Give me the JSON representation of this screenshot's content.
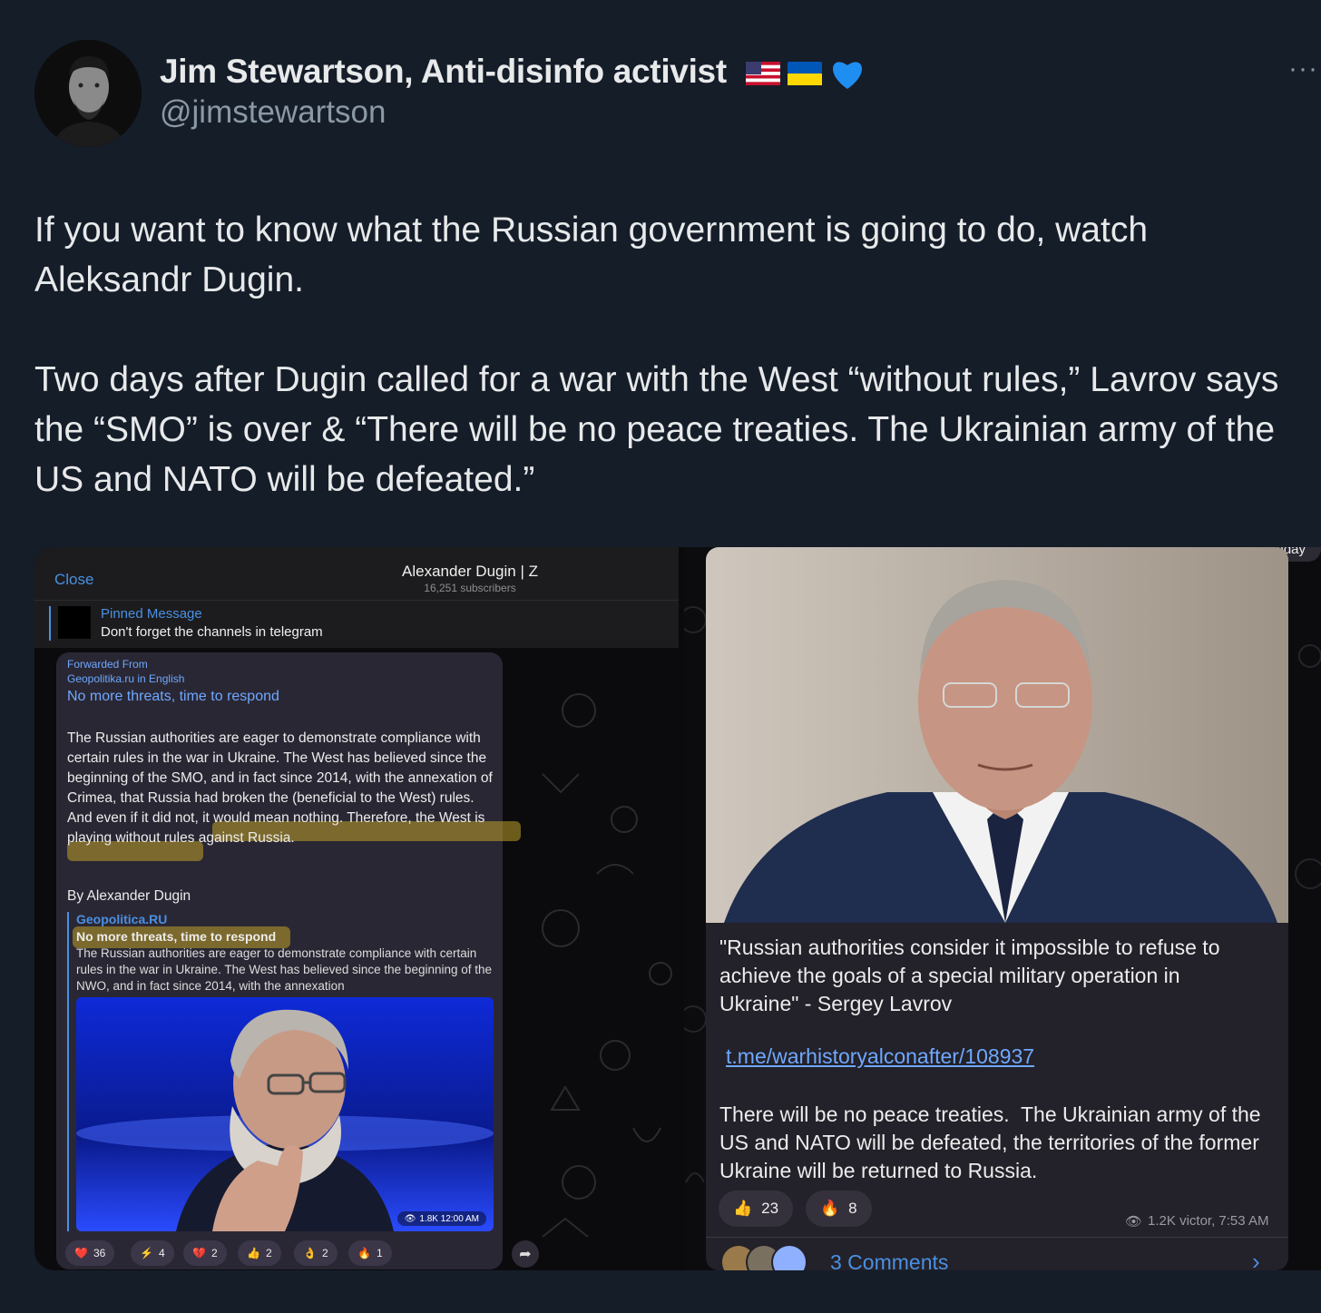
{
  "tweet": {
    "author_name": "Jim Stewartson, Anti-disinfo activist",
    "handle": "@jimstewartson",
    "more_label": "···",
    "text": "If you want to know what the Russian government is going to do, watch Aleksandr Dugin.\n\nTwo days after Dugin called for a war with the West “without rules,” Lavrov says the “SMO” is over & “There will be no peace treaties. The Ukrainian army of the US and NATO will be defeated.”",
    "flag_icons": [
      "us-flag-icon",
      "ukraine-flag-icon",
      "blue-heart-icon"
    ]
  },
  "left_screenshot": {
    "close_label": "Close",
    "channel_name": "Alexander Dugin | Z",
    "subscribers": "16,251 subscribers",
    "pinned_title": "Pinned Message",
    "pinned_text": "Don't forget the channels in telegram",
    "forwarded_label": "Forwarded From",
    "forwarded_source": "Geopolitika.ru in English",
    "headline": "No more threats, time to respond",
    "body": "The Russian authorities are eager to demonstrate compliance with certain rules in the war in Ukraine. The West has believed since the beginning of the SMO, and in fact since 2014, with the annexation of Crimea, that Russia had broken the (beneficial to the West) rules. And even if it did not, it would mean nothing. Therefore, the West is playing without rules against Russia.",
    "byline": "By Alexander Dugin",
    "preview_site": "Geopolitica.RU",
    "preview_title": "No more threats, time to respond",
    "preview_text": "The Russian authorities are eager to demonstrate compliance with certain rules in the war in Ukraine. The West has believed since the beginning of the NWO, and in fact since 2014, with the annexation",
    "image_meta": "1.8K 12:00 AM",
    "reactions": [
      {
        "emoji": "❤️",
        "count": "36"
      },
      {
        "emoji": "⚡",
        "count": "4"
      },
      {
        "emoji": "💔",
        "count": "2"
      },
      {
        "emoji": "👍",
        "count": "2"
      },
      {
        "emoji": "👌",
        "count": "2"
      },
      {
        "emoji": "🔥",
        "count": "1"
      }
    ]
  },
  "right_screenshot": {
    "date_chip": "Today",
    "quote": "\"Russian authorities consider it impossible to refuse to achieve the goals of a special military operation in Ukraine\" - Sergey Lavrov",
    "link": "t.me/warhistoryalconafter/108937",
    "body": "There will be no peace treaties.  The Ukrainian army of the US and NATO will be defeated, the territories of the former Ukraine will be returned to Russia.",
    "reactions": [
      {
        "emoji": "👍",
        "count": "23"
      },
      {
        "emoji": "🔥",
        "count": "8"
      }
    ],
    "meta": "1.2K victor, 7:53 AM",
    "comments_label": "3 Comments"
  }
}
